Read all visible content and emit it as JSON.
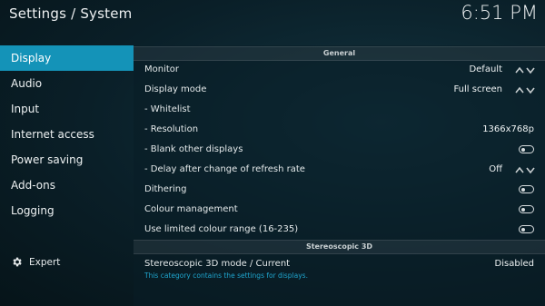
{
  "header": {
    "title": "Settings / System",
    "clock": "6:51 PM"
  },
  "sidebar": {
    "items": [
      {
        "label": "Display"
      },
      {
        "label": "Audio"
      },
      {
        "label": "Input"
      },
      {
        "label": "Internet access"
      },
      {
        "label": "Power saving"
      },
      {
        "label": "Add-ons"
      },
      {
        "label": "Logging"
      }
    ],
    "expert_label": "Expert"
  },
  "groups": {
    "general": "General",
    "stereoscopic": "Stereoscopic 3D"
  },
  "settings": [
    {
      "label": "Monitor",
      "value": "Default",
      "control": "spinner"
    },
    {
      "label": "Display mode",
      "value": "Full screen",
      "control": "spinner"
    },
    {
      "label": "- Whitelist",
      "value": "",
      "control": "none"
    },
    {
      "label": "- Resolution",
      "value": "1366x768p",
      "control": "none"
    },
    {
      "label": "- Blank other displays",
      "value": "",
      "control": "toggle-off"
    },
    {
      "label": "- Delay after change of refresh rate",
      "value": "Off",
      "control": "spinner"
    },
    {
      "label": "Dithering",
      "value": "",
      "control": "toggle-off"
    },
    {
      "label": "Colour management",
      "value": "",
      "control": "toggle-off"
    },
    {
      "label": "Use limited colour range (16-235)",
      "value": "",
      "control": "toggle-off"
    }
  ],
  "stereo_settings": [
    {
      "label": "Stereoscopic 3D mode / Current",
      "value": "Disabled",
      "control": "none"
    }
  ],
  "description": "This category contains the settings for displays.",
  "colors": {
    "accent": "#1493b8",
    "description": "#1fa6cf"
  }
}
